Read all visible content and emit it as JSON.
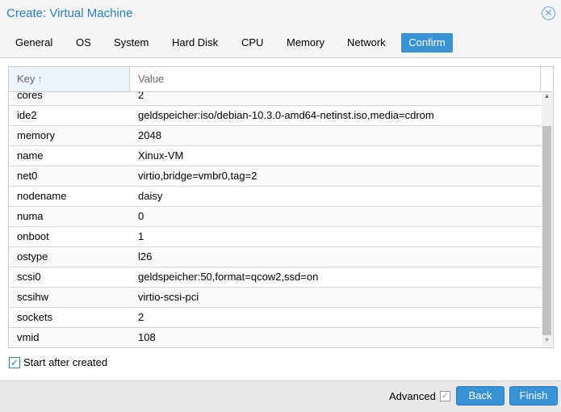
{
  "window": {
    "title": "Create: Virtual Machine",
    "close_icon": "close-circle-icon"
  },
  "tabs": [
    {
      "label": "General"
    },
    {
      "label": "OS"
    },
    {
      "label": "System"
    },
    {
      "label": "Hard Disk"
    },
    {
      "label": "CPU"
    },
    {
      "label": "Memory"
    },
    {
      "label": "Network"
    },
    {
      "label": "Confirm",
      "active": true
    }
  ],
  "grid": {
    "columns": {
      "key": "Key",
      "value": "Value"
    },
    "sort_icon": "arrow-up-icon",
    "rows": [
      {
        "key": "cores",
        "value": "2"
      },
      {
        "key": "ide2",
        "value": "geldspeicher:iso/debian-10.3.0-amd64-netinst.iso,media=cdrom"
      },
      {
        "key": "memory",
        "value": "2048"
      },
      {
        "key": "name",
        "value": "Xinux-VM"
      },
      {
        "key": "net0",
        "value": "virtio,bridge=vmbr0,tag=2"
      },
      {
        "key": "nodename",
        "value": "daisy"
      },
      {
        "key": "numa",
        "value": "0"
      },
      {
        "key": "onboot",
        "value": "1"
      },
      {
        "key": "ostype",
        "value": "l26"
      },
      {
        "key": "scsi0",
        "value": "geldspeicher:50,format=qcow2,ssd=on"
      },
      {
        "key": "scsihw",
        "value": "virtio-scsi-pci"
      },
      {
        "key": "sockets",
        "value": "2"
      },
      {
        "key": "vmid",
        "value": "108"
      }
    ]
  },
  "start_after_created": {
    "label": "Start after created",
    "checked": true
  },
  "footer": {
    "advanced_label": "Advanced",
    "advanced_checked": true,
    "back": "Back",
    "finish": "Finish"
  },
  "colors": {
    "accent": "#3892d4",
    "title": "#2c7fcb"
  }
}
